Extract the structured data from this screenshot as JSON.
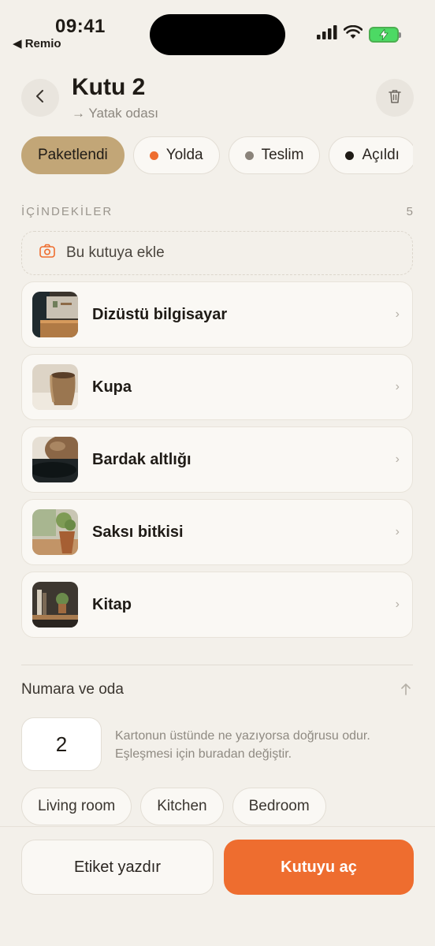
{
  "status_bar": {
    "time": "09:41",
    "back_app": "◀ Remio",
    "battery_icon": "battery-charging-icon",
    "signal_icon": "cellular-signal-icon",
    "wifi_icon": "wifi-icon"
  },
  "header": {
    "title": "Kutu 2",
    "subtitle": "→ Yatak odası",
    "back_icon": "chevron-left-icon",
    "delete_icon": "trash-icon"
  },
  "status_chips": [
    {
      "label": "Paketlendi",
      "active": true,
      "dot_color": null
    },
    {
      "label": "Yolda",
      "active": false,
      "dot_color": "#ee6d2f"
    },
    {
      "label": "Teslim",
      "active": false,
      "dot_color": "#8a837a"
    },
    {
      "label": "Açıldı",
      "active": false,
      "dot_color": "#1f1b16"
    }
  ],
  "contents": {
    "section_label": "İÇİNDEKİLER",
    "count": "5",
    "add_label": "Bu kutuya ekle",
    "add_icon": "camera-icon",
    "items": [
      {
        "name": "Dizüstü bilgisayar",
        "thumb": "laptop-photo"
      },
      {
        "name": "Kupa",
        "thumb": "mug-photo"
      },
      {
        "name": "Bardak altlığı",
        "thumb": "coaster-photo"
      },
      {
        "name": "Saksı bitkisi",
        "thumb": "potted-plant-photo"
      },
      {
        "name": "Kitap",
        "thumb": "book-photo"
      }
    ],
    "chevron": "›"
  },
  "number_section": {
    "title": "Numara ve oda",
    "number_value": "2",
    "hint": "Kartonun üstünde ne yazıyorsa doğrusu odur. Eşleşmesi için buradan değiştir.",
    "rooms": [
      "Living room",
      "Kitchen",
      "Bedroom"
    ]
  },
  "actions": {
    "print_label": "Etiket yazdır",
    "open_box": "Kutuyu aç"
  },
  "colors": {
    "accent": "#ee6d2f",
    "active_chip": "#c2a677",
    "background": "#f3f0ea"
  }
}
